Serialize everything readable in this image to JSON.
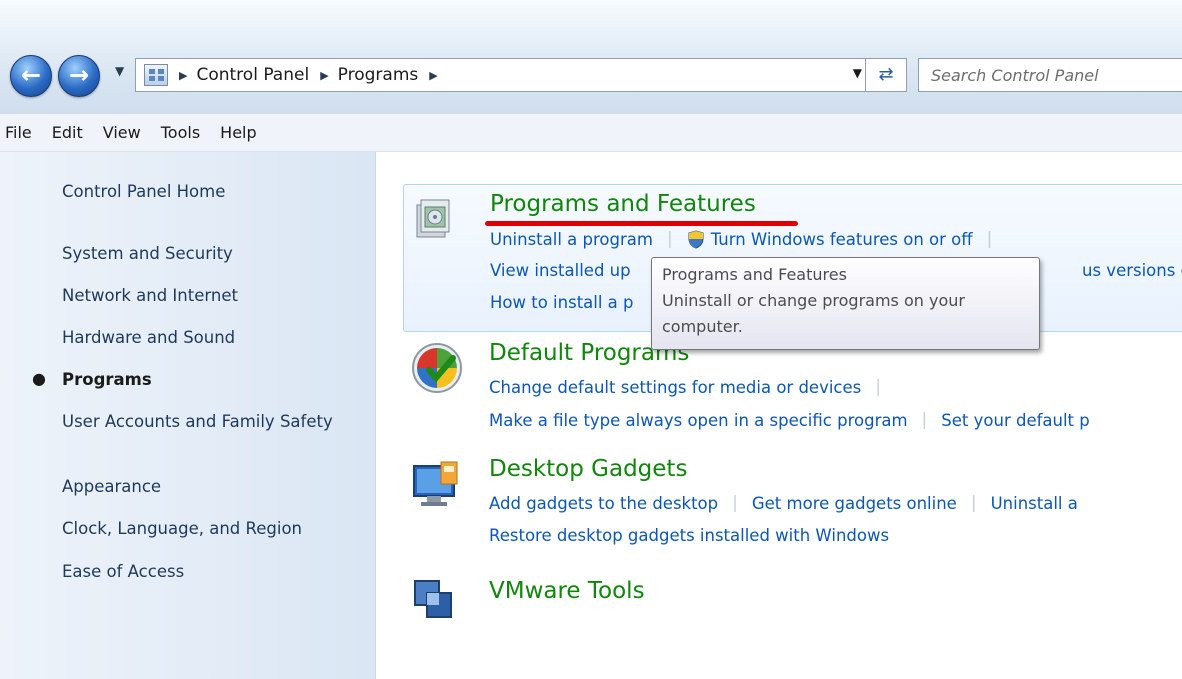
{
  "address_bar": {
    "breadcrumbs": [
      "Control Panel",
      "Programs"
    ],
    "search_placeholder": "Search Control Panel"
  },
  "menu": [
    "File",
    "Edit",
    "View",
    "Tools",
    "Help"
  ],
  "sidebar": {
    "home": "Control Panel Home",
    "items": [
      "System and Security",
      "Network and Internet",
      "Hardware and Sound",
      "Programs",
      "User Accounts and Family Safety",
      "Appearance",
      "Clock, Language, and Region",
      "Ease of Access"
    ],
    "current_index": 3
  },
  "categories": {
    "programs_features": {
      "title": "Programs and Features",
      "links": {
        "uninstall": "Uninstall a program",
        "windows_features": "Turn Windows features on or off",
        "view_updates": "View installed up",
        "install": "How to install a p",
        "previous_versions": "us versions of V"
      }
    },
    "default_programs": {
      "title": "Default Programs",
      "links": {
        "media_defaults": "Change default settings for media or devices",
        "file_type": "Make a file type always open in a specific program",
        "set_defaults": "Set your default p"
      }
    },
    "desktop_gadgets": {
      "title": "Desktop Gadgets",
      "links": {
        "add_gadgets": "Add gadgets to the desktop",
        "more_gadgets": "Get more gadgets online",
        "uninstall_gadget": "Uninstall a",
        "restore_gadgets": "Restore desktop gadgets installed with Windows"
      }
    },
    "vmware_tools": {
      "title": "VMware Tools"
    }
  },
  "tooltip": {
    "title": "Programs and Features",
    "description": "Uninstall or change programs on your computer."
  },
  "colors": {
    "category_title": "#10860b",
    "task_link": "#0b56b8",
    "sidebar_link": "#1e395b",
    "highlight_underline": "#e00000"
  }
}
